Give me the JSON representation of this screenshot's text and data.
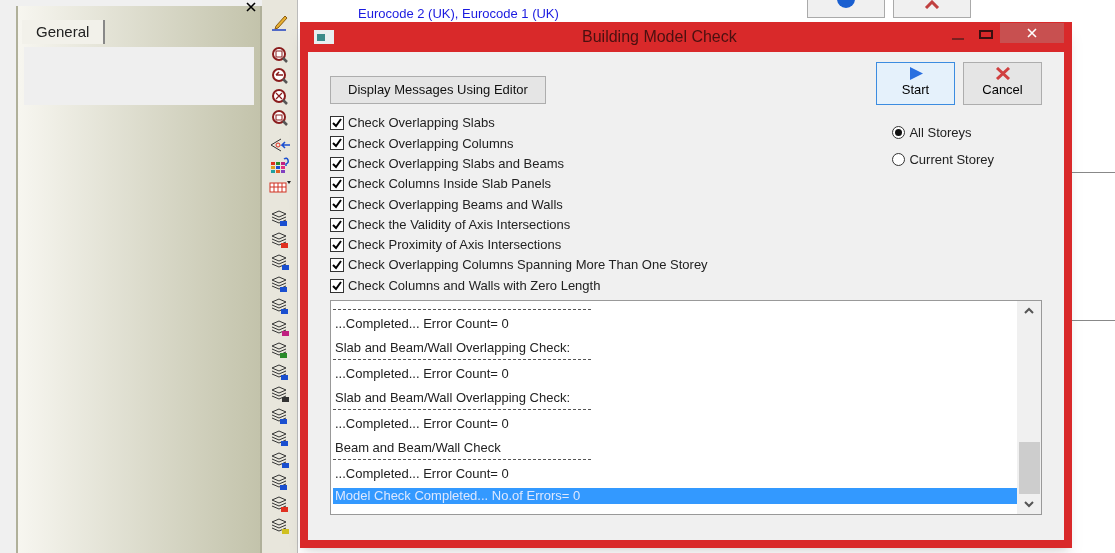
{
  "background": {
    "link": "Eurocode 2 (UK),  Eurocode 1 (UK)",
    "panel": {
      "tabs": [
        {
          "label": "General",
          "selected": true
        }
      ]
    }
  },
  "dialog": {
    "title": "Building Model Check",
    "display_button": "Display Messages Using Editor",
    "start_button": "Start",
    "cancel_button": "Cancel",
    "checks": [
      {
        "label": "Check Overlapping Slabs",
        "checked": true
      },
      {
        "label": "Check Overlapping Columns",
        "checked": true
      },
      {
        "label": "Check Overlapping Slabs and Beams",
        "checked": true
      },
      {
        "label": "Check Columns Inside Slab Panels",
        "checked": true
      },
      {
        "label": "Check Overlapping Beams and Walls",
        "checked": true
      },
      {
        "label": "Check the Validity of Axis Intersections",
        "checked": true
      },
      {
        "label": "Check Proximity of Axis Intersections",
        "checked": true
      },
      {
        "label": "Check Overlapping Columns Spanning More Than One Storey",
        "checked": true
      },
      {
        "label": "Check Columns and Walls with Zero Length",
        "checked": true
      }
    ],
    "scope": [
      {
        "label": "All Storeys",
        "selected": true
      },
      {
        "label": "Current Storey",
        "selected": false
      }
    ],
    "log": [
      {
        "kind": "separator"
      },
      {
        "kind": "result",
        "text": "...Completed... Error Count= 0",
        "selected": false
      },
      {
        "kind": "heading",
        "text": "Slab and Beam/Wall Overlapping Check:",
        "selected": false
      },
      {
        "kind": "separator"
      },
      {
        "kind": "result",
        "text": "...Completed... Error Count= 0",
        "selected": false
      },
      {
        "kind": "heading",
        "text": "Slab and Beam/Wall Overlapping Check:",
        "selected": false
      },
      {
        "kind": "separator"
      },
      {
        "kind": "result",
        "text": "...Completed... Error Count= 0",
        "selected": false
      },
      {
        "kind": "heading",
        "text": "Beam and Beam/Wall Check",
        "selected": false
      },
      {
        "kind": "separator"
      },
      {
        "kind": "result",
        "text": "...Completed... Error Count= 0",
        "selected": false
      },
      {
        "kind": "result",
        "text": "Model Check Completed... No.of Errors= 0",
        "selected": true
      }
    ]
  }
}
